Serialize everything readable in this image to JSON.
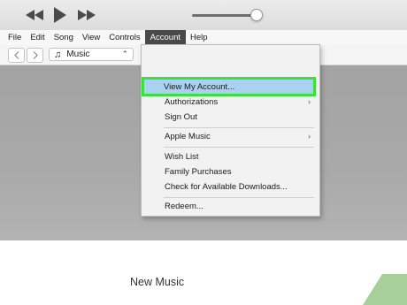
{
  "player": {
    "icons": [
      "rewind-icon",
      "play-icon",
      "fast-forward-icon"
    ]
  },
  "menubar": {
    "items": [
      "File",
      "Edit",
      "Song",
      "View",
      "Controls",
      "Account",
      "Help"
    ],
    "active": "Account"
  },
  "toolbar": {
    "back_icon": "chevron-left-icon",
    "forward_icon": "chevron-right-icon",
    "source_label": "Music"
  },
  "account_menu": {
    "items": [
      {
        "label": "View My Account...",
        "highlighted": true
      },
      {
        "label": "Authorizations",
        "submenu": true
      },
      {
        "label": "Sign Out"
      },
      {
        "label": "Apple Music",
        "submenu": true
      },
      {
        "label": "Wish List"
      },
      {
        "label": "Family Purchases"
      },
      {
        "label": "Check for Available Downloads..."
      },
      {
        "label": "Redeem..."
      }
    ]
  },
  "content": {
    "section_title": "New Music"
  },
  "colors": {
    "highlight_border": "#3ce03c",
    "highlight_fill": "#a9d2f2",
    "active_menu": "#4a4a4a",
    "content_gray": "#a8a8a8",
    "green_shape": "#a6cf9a"
  }
}
